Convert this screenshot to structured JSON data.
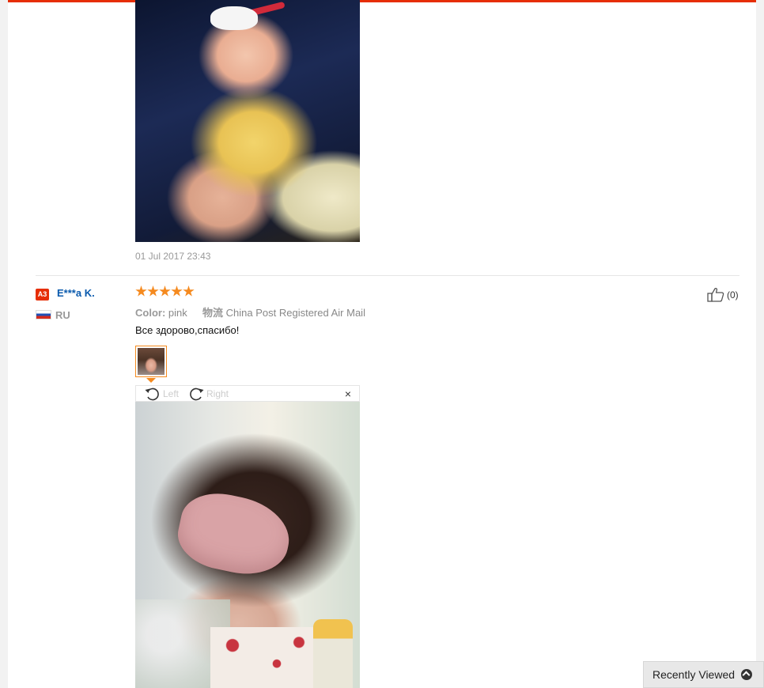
{
  "previous_review": {
    "date": "01 Jul 2017 23:43"
  },
  "review": {
    "buyer": {
      "level_badge": "A3",
      "name": "E***a K.",
      "country": "RU"
    },
    "rating_stars": 5,
    "attributes": {
      "color_label": "Color:",
      "color_value": "pink",
      "logistics_label": "物流",
      "logistics_value": "China Post Registered Air Mail"
    },
    "text": "Все здорово,спасибо!",
    "helpful_count": "(0)",
    "viewer": {
      "rotate_left": "Left",
      "rotate_right": "Right",
      "close": "×"
    }
  },
  "recently_viewed": {
    "label": "Recently Viewed"
  },
  "colors": {
    "accent": "#e62e04",
    "star": "#f58a1f",
    "link": "#0a5aad"
  }
}
